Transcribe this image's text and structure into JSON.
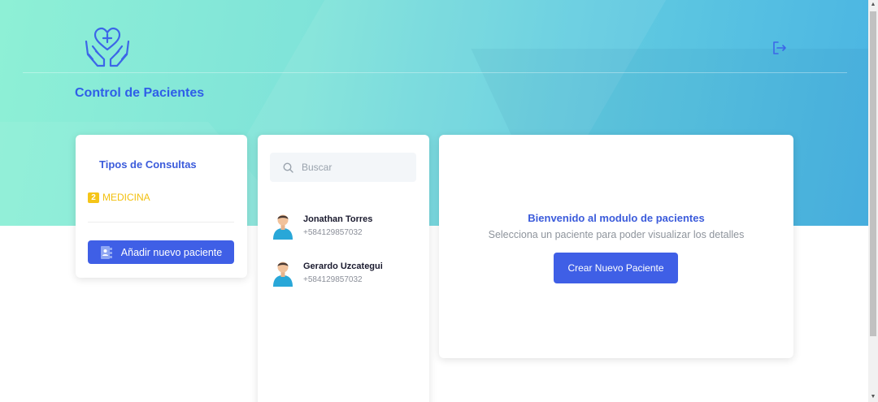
{
  "header": {
    "app_title": "Control de Pacientes"
  },
  "icons": {
    "logo": "hands-heart-icon",
    "logout": "logout-icon",
    "search": "search-icon",
    "add_patient": "address-book-icon",
    "avatar": "user-avatar-icon"
  },
  "colors": {
    "primary": "#3f5fe6",
    "title_blue": "#3b5bdb",
    "badge_yellow": "#f5c518",
    "hero_start": "#8ef0d6",
    "hero_end": "#4ab4e3"
  },
  "consult_types": {
    "title": "Tipos de Consultas",
    "items": [
      {
        "count": "2",
        "label": "MEDICINA"
      }
    ],
    "add_button_label": "Añadir nuevo paciente"
  },
  "patients": {
    "search_placeholder": "Buscar",
    "items": [
      {
        "name": "Jonathan Torres",
        "phone": "+584129857032"
      },
      {
        "name": "Gerardo Uzcategui",
        "phone": "+584129857032"
      }
    ]
  },
  "welcome_panel": {
    "title": "Bienvenido al modulo de pacientes",
    "subtitle": "Selecciona un paciente para poder visualizar los detalles",
    "create_button_label": "Crear Nuevo Paciente"
  }
}
